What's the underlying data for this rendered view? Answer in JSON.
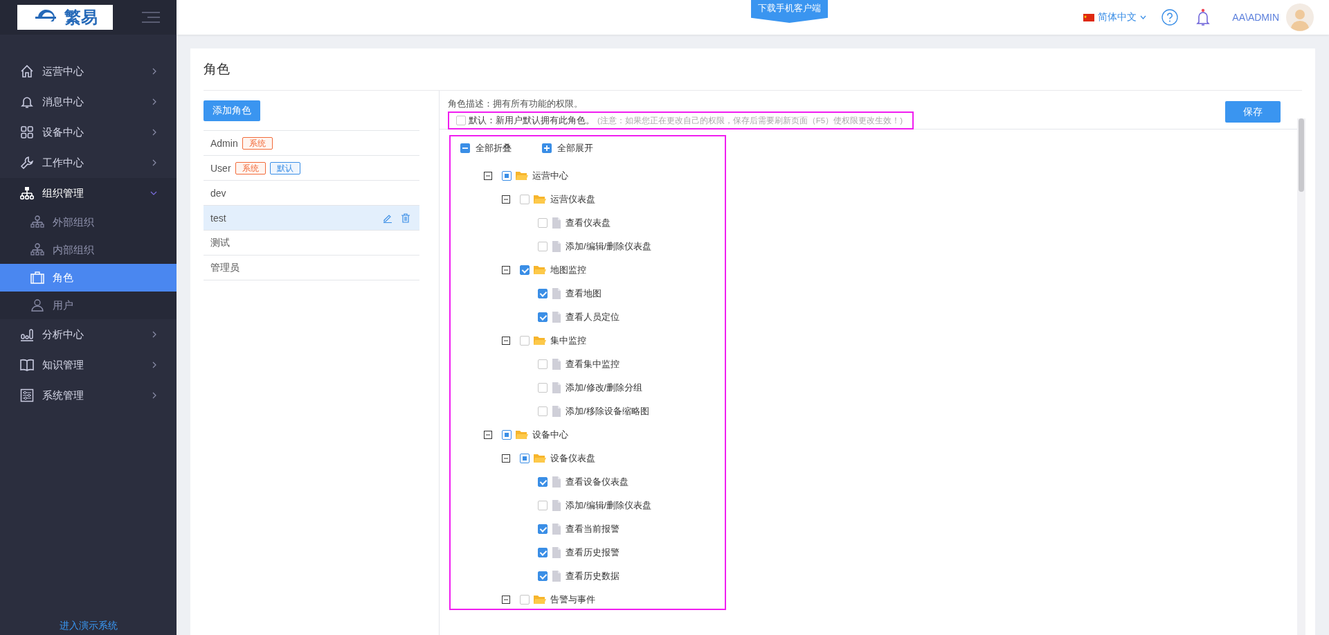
{
  "logo": {
    "text": "繁易"
  },
  "sidebar": {
    "items": [
      {
        "label": "运营中心",
        "expanded": false,
        "selected": false
      },
      {
        "label": "消息中心",
        "expanded": false,
        "selected": false
      },
      {
        "label": "设备中心",
        "expanded": false,
        "selected": false
      },
      {
        "label": "工作中心",
        "expanded": false,
        "selected": false
      },
      {
        "label": "组织管理",
        "expanded": true,
        "selected": false,
        "children": [
          {
            "label": "外部组织",
            "selected": false
          },
          {
            "label": "内部组织",
            "selected": false
          },
          {
            "label": "角色",
            "selected": true
          },
          {
            "label": "用户",
            "selected": false
          }
        ]
      },
      {
        "label": "分析中心",
        "expanded": false,
        "selected": false
      },
      {
        "label": "知识管理",
        "expanded": false,
        "selected": false
      },
      {
        "label": "系统管理",
        "expanded": false,
        "selected": false
      }
    ],
    "footer_link": "进入演示系统"
  },
  "header": {
    "download_button": "下载手机客户端",
    "language": "简体中文",
    "notification_dot": true,
    "user": "AA\\ADMIN"
  },
  "page": {
    "title": "角色"
  },
  "roles": {
    "add_button": "添加角色",
    "items": [
      {
        "name": "Admin",
        "selected": false,
        "tags": [
          {
            "label": "系统",
            "kind": "system"
          }
        ]
      },
      {
        "name": "User",
        "selected": false,
        "tags": [
          {
            "label": "系统",
            "kind": "system"
          },
          {
            "label": "默认",
            "kind": "default"
          }
        ]
      },
      {
        "name": "dev",
        "selected": false
      },
      {
        "name": "test",
        "selected": true
      },
      {
        "name": "测试",
        "selected": false
      },
      {
        "name": "管理员",
        "selected": false
      }
    ]
  },
  "detail": {
    "description": "角色描述：拥有所有功能的权限。",
    "default_checkbox": {
      "checked": false,
      "label": "默认：新用户默认拥有此角色。",
      "note": "(注意：如果您正在更改自己的权限，保存后需要刷新页面（F5）使权限更改生效！)"
    },
    "save_button": "保存",
    "collapse_all": "全部折叠",
    "expand_all": "全部展开"
  },
  "tree": [
    {
      "label": "运营中心",
      "kind": "folder",
      "expanded": true,
      "checked": false,
      "indeterminate": true,
      "children": [
        {
          "label": "运营仪表盘",
          "kind": "folder",
          "expanded": true,
          "checked": false,
          "indeterminate": false,
          "children": [
            {
              "label": "查看仪表盘",
              "kind": "page",
              "checked": false,
              "indeterminate": false
            },
            {
              "label": "添加/编辑/删除仪表盘",
              "kind": "page",
              "checked": false,
              "indeterminate": false
            }
          ]
        },
        {
          "label": "地图监控",
          "kind": "folder",
          "expanded": true,
          "checked": true,
          "indeterminate": false,
          "children": [
            {
              "label": "查看地图",
              "kind": "page",
              "checked": true,
              "indeterminate": false
            },
            {
              "label": "查看人员定位",
              "kind": "page",
              "checked": true,
              "indeterminate": false
            }
          ]
        },
        {
          "label": "集中监控",
          "kind": "folder",
          "expanded": true,
          "checked": false,
          "indeterminate": false,
          "children": [
            {
              "label": "查看集中监控",
              "kind": "page",
              "checked": false,
              "indeterminate": false
            },
            {
              "label": "添加/修改/删除分组",
              "kind": "page",
              "checked": false,
              "indeterminate": false
            },
            {
              "label": "添加/移除设备缩略图",
              "kind": "page",
              "checked": false,
              "indeterminate": false
            }
          ]
        }
      ]
    },
    {
      "label": "设备中心",
      "kind": "folder",
      "expanded": true,
      "checked": false,
      "indeterminate": true,
      "children": [
        {
          "label": "设备仪表盘",
          "kind": "folder",
          "expanded": true,
          "checked": false,
          "indeterminate": true,
          "children": [
            {
              "label": "查看设备仪表盘",
              "kind": "page",
              "checked": true,
              "indeterminate": false
            },
            {
              "label": "添加/编辑/删除仪表盘",
              "kind": "page",
              "checked": false,
              "indeterminate": false
            },
            {
              "label": "查看当前报警",
              "kind": "page",
              "checked": true,
              "indeterminate": false
            },
            {
              "label": "查看历史报警",
              "kind": "page",
              "checked": true,
              "indeterminate": false
            },
            {
              "label": "查看历史数据",
              "kind": "page",
              "checked": true,
              "indeterminate": false
            }
          ]
        },
        {
          "label": "告警与事件",
          "kind": "folder",
          "expanded": true,
          "checked": false,
          "indeterminate": false
        }
      ]
    }
  ]
}
